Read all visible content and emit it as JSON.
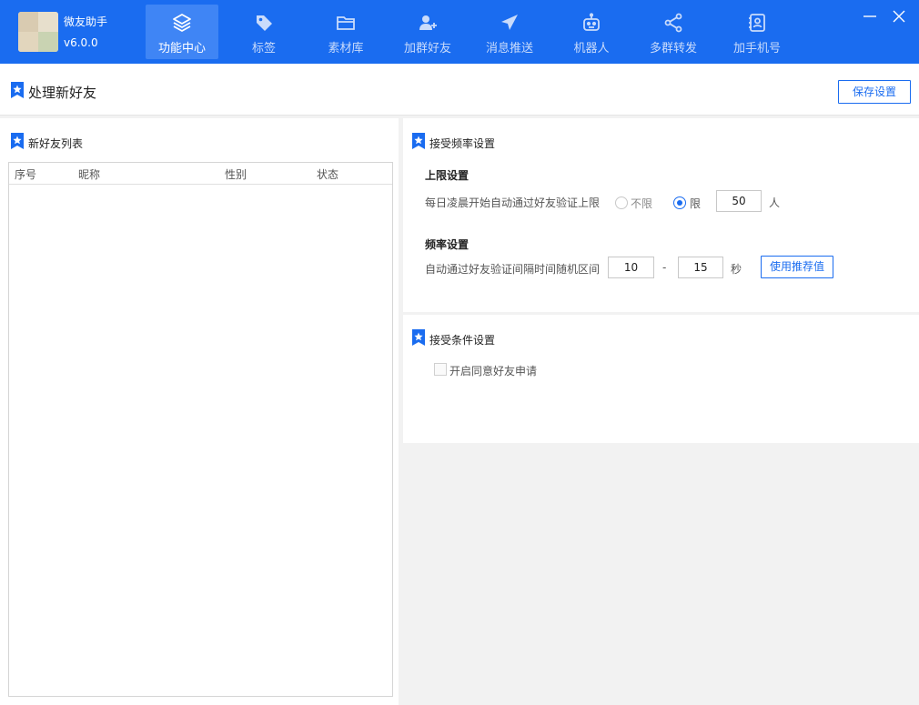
{
  "app": {
    "name": "微友助手",
    "version": "v6.0.0"
  },
  "nav": [
    {
      "label": "功能中心",
      "icon": "layers-icon",
      "active": true
    },
    {
      "label": "标签",
      "icon": "tag-icon",
      "active": false
    },
    {
      "label": "素材库",
      "icon": "folder-icon",
      "active": false
    },
    {
      "label": "加群好友",
      "icon": "add-user-icon",
      "active": false
    },
    {
      "label": "消息推送",
      "icon": "paper-plane-icon",
      "active": false
    },
    {
      "label": "机器人",
      "icon": "robot-icon",
      "active": false
    },
    {
      "label": "多群转发",
      "icon": "share-icon",
      "active": false
    },
    {
      "label": "加手机号",
      "icon": "contact-book-icon",
      "active": false
    }
  ],
  "page": {
    "title": "处理新好友",
    "save_label": "保存设置"
  },
  "friend_list": {
    "title": "新好友列表",
    "columns": [
      "序号",
      "昵称",
      "性别",
      "状态"
    ],
    "rows": []
  },
  "frequency": {
    "title": "接受频率设置",
    "limit_heading": "上限设置",
    "limit_label": "每日凌晨开始自动通过好友验证上限",
    "opt_unlimited": "不限",
    "opt_limited": "限",
    "selected": "limited",
    "limit_value": "50",
    "limit_unit": "人",
    "rate_heading": "频率设置",
    "rate_label": "自动通过好友验证间隔时间随机区间",
    "rate_min": "10",
    "rate_sep": "-",
    "rate_max": "15",
    "rate_unit": "秒",
    "recommend_label": "使用推荐值"
  },
  "conditions": {
    "title": "接受条件设置",
    "enable_label": "开启同意好友申请",
    "enabled": false
  },
  "colors": {
    "brand": "#1a6cf0",
    "nav_active": "#3f85f5"
  }
}
